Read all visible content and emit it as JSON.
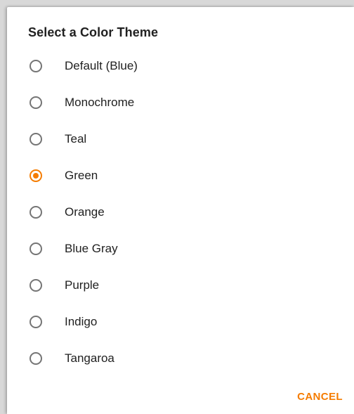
{
  "dialog": {
    "title": "Select a Color Theme",
    "accent_color": "#f57c00",
    "selected_index": 3,
    "options": [
      {
        "label": "Default (Blue)",
        "checked": false
      },
      {
        "label": "Monochrome",
        "checked": false
      },
      {
        "label": "Teal",
        "checked": false
      },
      {
        "label": "Green",
        "checked": true
      },
      {
        "label": "Orange",
        "checked": false
      },
      {
        "label": "Blue Gray",
        "checked": false
      },
      {
        "label": "Purple",
        "checked": false
      },
      {
        "label": "Indigo",
        "checked": false
      },
      {
        "label": "Tangaroa",
        "checked": false
      }
    ],
    "cancel_label": "CANCEL"
  }
}
